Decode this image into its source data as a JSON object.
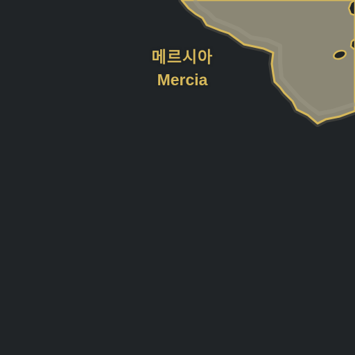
{
  "map": {
    "region_label": {
      "native": "메르시아",
      "latin": "Mercia"
    },
    "colors": {
      "sea": "#202427",
      "land": "#8b8775",
      "land_highlight": "#9a9684",
      "border_gold": "#d6b85a",
      "border_shadow": "#3c3d3a",
      "label": "#d6b85a"
    }
  }
}
